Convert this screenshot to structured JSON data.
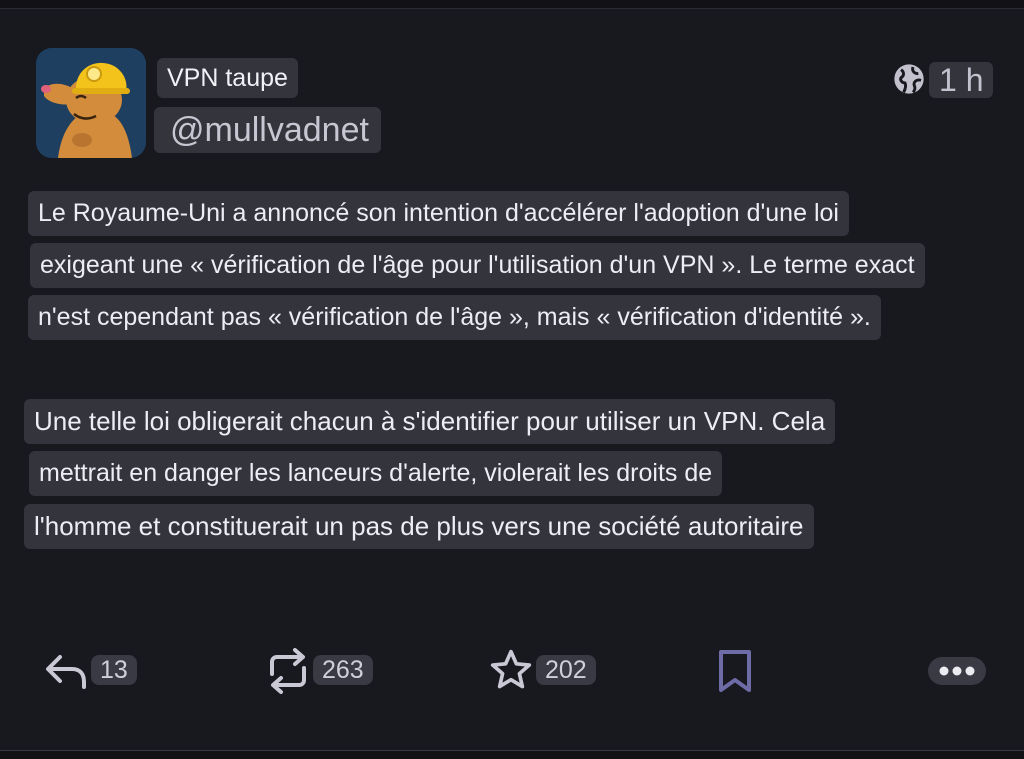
{
  "author": {
    "display_name": "VPN taupe",
    "handle": "@mullvadnet",
    "avatar_icon": "mole-miner-avatar-icon"
  },
  "meta": {
    "visibility_icon": "globe-icon",
    "time": "1 h"
  },
  "content": {
    "paragraph1": [
      "Le Royaume-Uni a annoncé son intention d'accélérer l'adoption d'une loi",
      "exigeant une « vérification de l'âge pour l'utilisation d'un VPN ». Le terme exact",
      "n'est cependant pas « vérification de l'âge », mais « vérification d'identité »."
    ],
    "paragraph2": [
      "Une telle loi obligerait chacun à s'identifier pour utiliser un VPN. Cela",
      "mettrait en danger les lanceurs d'alerte, violerait les droits de",
      "l'homme et constituerait un pas de plus vers une société autoritaire"
    ]
  },
  "actions": {
    "reply": {
      "icon": "reply-icon",
      "count": "13"
    },
    "boost": {
      "icon": "boost-icon",
      "count": "263"
    },
    "favourite": {
      "icon": "star-icon",
      "count": "202"
    },
    "bookmark": {
      "icon": "bookmark-icon"
    },
    "more": {
      "icon": "more-icon"
    }
  },
  "colors": {
    "background": "#18181f",
    "chip": "#34343d",
    "avatar_bg": "#1f3f61",
    "helmet": "#f3c21b",
    "mole": "#d28c3c"
  }
}
